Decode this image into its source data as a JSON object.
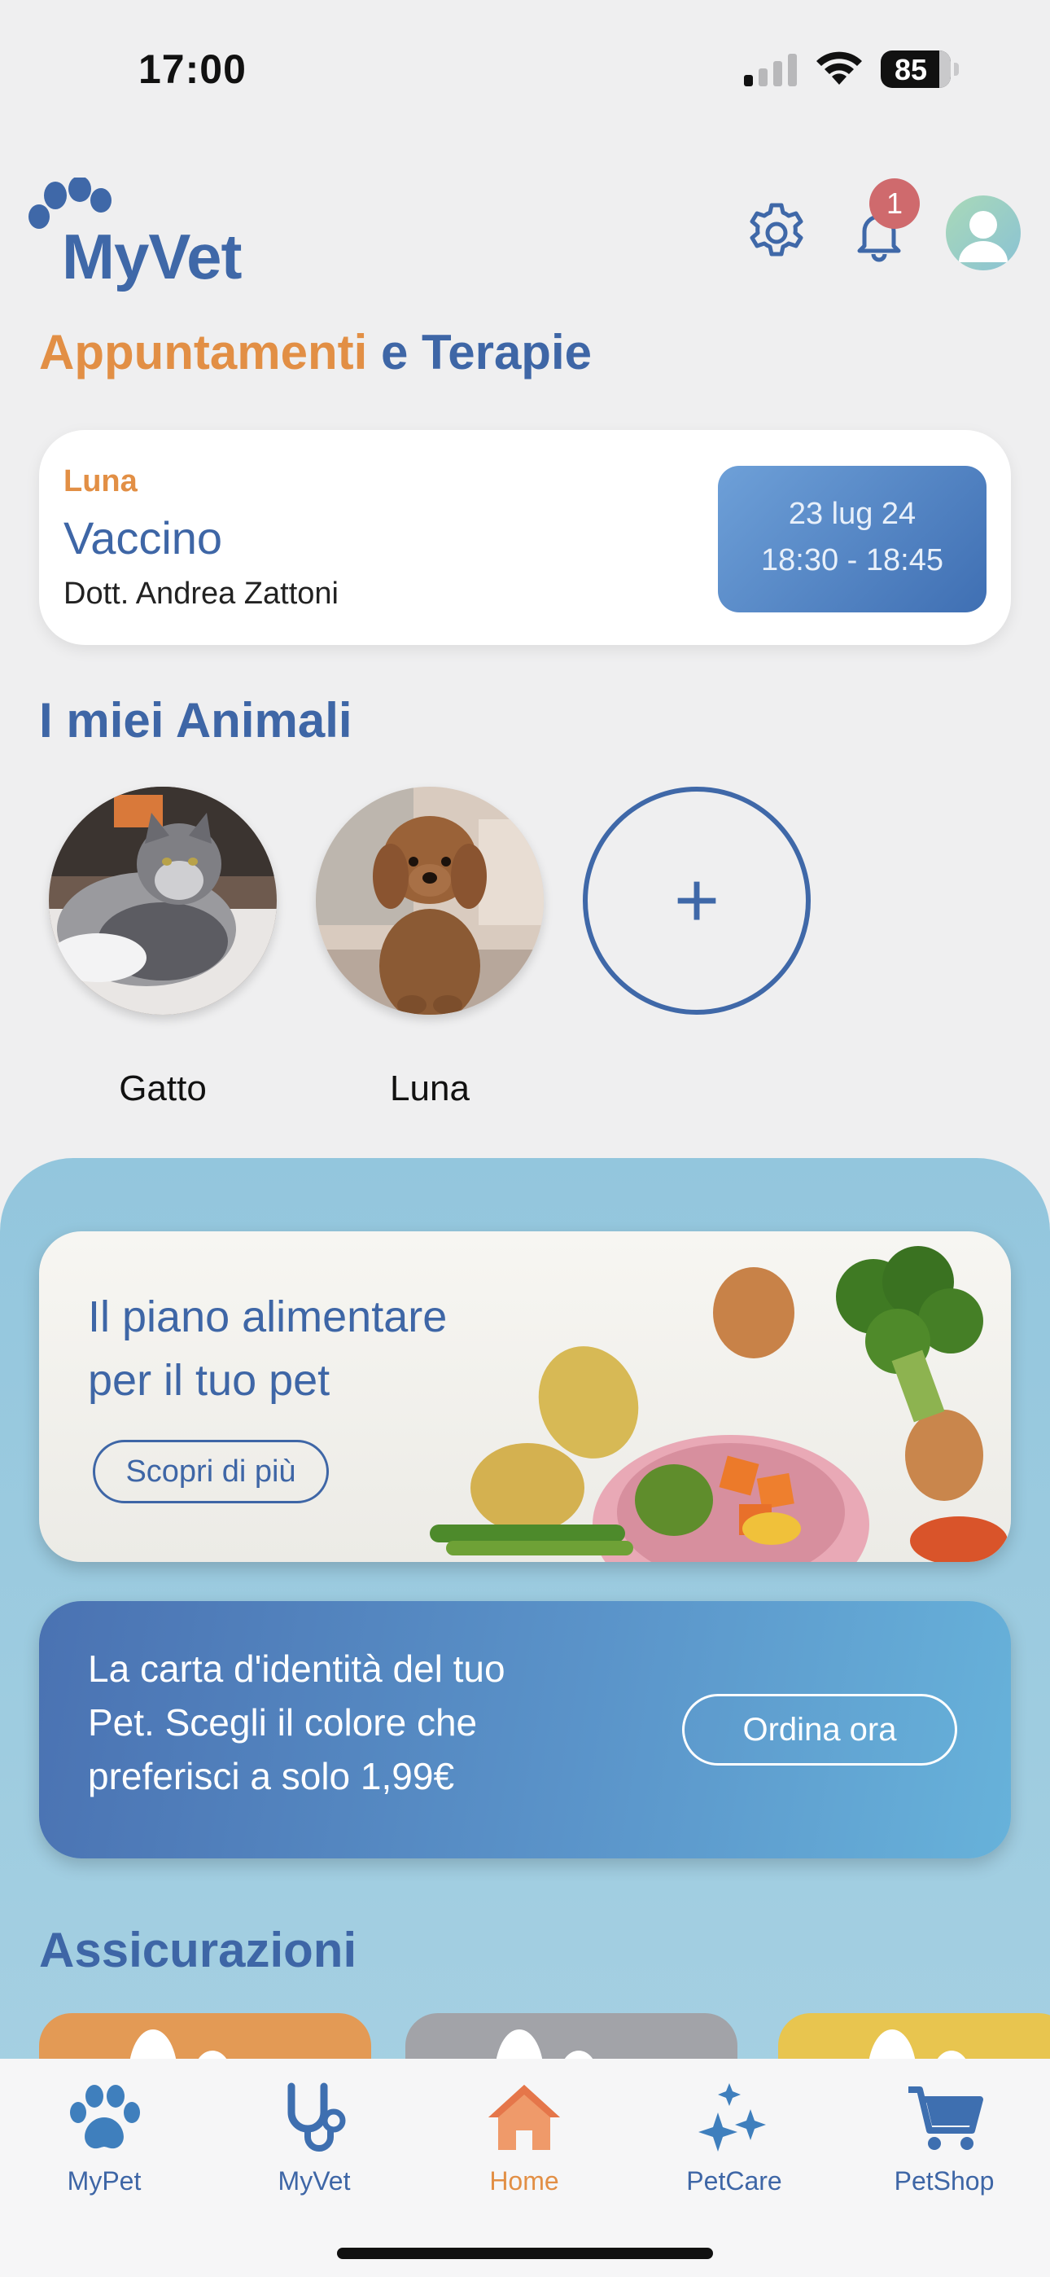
{
  "status_bar": {
    "time": "17:00",
    "battery": "85"
  },
  "header": {
    "app_name": "MyVet",
    "notification_count": "1"
  },
  "appointments": {
    "title_part1": "Appuntamenti",
    "title_part2": " e Terapie",
    "card": {
      "pet": "Luna",
      "type": "Vaccino",
      "doctor": "Dott. Andrea Zattoni",
      "date": "23 lug 24",
      "time": "18:30 - 18:45"
    }
  },
  "animals": {
    "title": "I miei Animali",
    "pets": [
      {
        "name": "Gatto"
      },
      {
        "name": "Luna"
      }
    ],
    "add_label": "+"
  },
  "promo_food": {
    "title_line1": "Il piano alimentare",
    "title_line2": "per il tuo pet",
    "button": "Scopri di più"
  },
  "promo_id": {
    "text": "La carta d'identità del tuo Pet. Scegli il colore che preferisci a solo 1,99€",
    "button": "Ordina ora"
  },
  "insurance": {
    "title": "Assicurazioni"
  },
  "tab_bar": {
    "tabs": [
      {
        "label": "MyPet",
        "icon": "paw-icon"
      },
      {
        "label": "MyVet",
        "icon": "stethoscope-icon"
      },
      {
        "label": "Home",
        "icon": "home-icon",
        "active": true
      },
      {
        "label": "PetCare",
        "icon": "sparkles-icon"
      },
      {
        "label": "PetShop",
        "icon": "cart-icon"
      }
    ]
  },
  "colors": {
    "primary": "#3e66a6",
    "accent": "#e28f45",
    "badge": "#cf6a6d",
    "panel": "#a9d2e3"
  }
}
